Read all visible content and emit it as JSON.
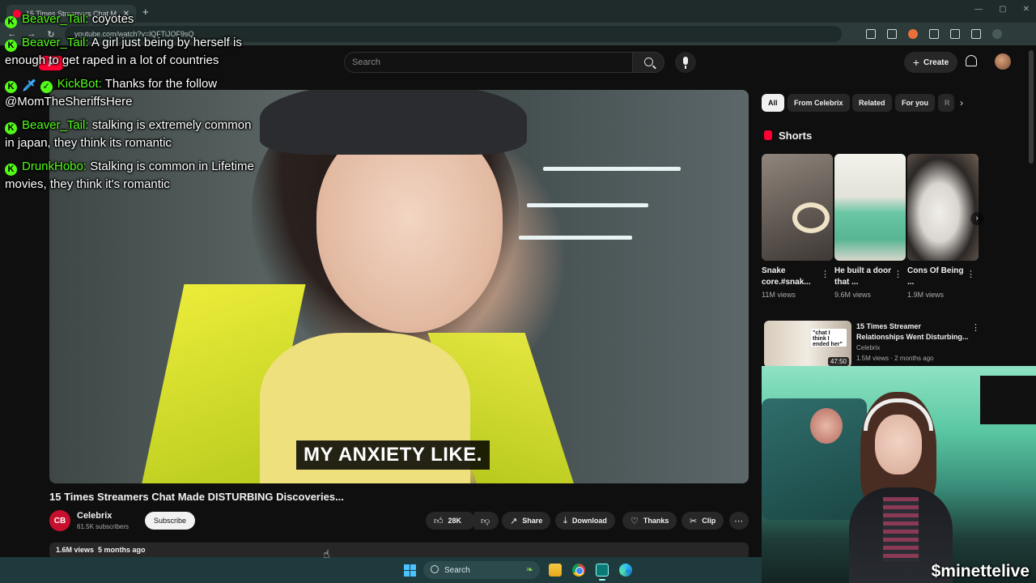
{
  "browser": {
    "tab_title": "15 Times Streamers Chat M",
    "url": "youtube.com/watch?v=lQFTiJOF9sQ"
  },
  "youtube": {
    "search_placeholder": "Search",
    "create_label": "Create"
  },
  "video": {
    "caption": "MY ANXIETY LIKE.",
    "title": "15 Times Streamers Chat Made DISTURBING Discoveries...",
    "channel": "Celebrix",
    "channel_initials": "CB",
    "subscribers": "61.5K subscribers",
    "subscribe_label": "Subscribe",
    "likes": "28K",
    "share_label": "Share",
    "download_label": "Download",
    "thanks_label": "Thanks",
    "clip_label": "Clip",
    "views": "1.6M views",
    "age": "5 months ago"
  },
  "sidebar": {
    "chips": [
      "All",
      "From Celebrix",
      "Related",
      "For you",
      "R"
    ],
    "shorts_label": "Shorts",
    "shorts": [
      {
        "title": "Snake core.#snak...",
        "views": "11M views"
      },
      {
        "title": "He built a door that ...",
        "views": "9.6M views"
      },
      {
        "title": "Cons Of Being ...",
        "views": "1.9M views"
      }
    ],
    "related": {
      "title": "15 Times Streamer Relationships Went Disturbing...",
      "channel": "Celebrix",
      "meta": "1.5M views · 2 months ago",
      "duration": "47:50",
      "thumb_text": "\"chat I think I ended her\""
    }
  },
  "chat": [
    {
      "user": "Beaver_Tail:",
      "text": "coyotes",
      "badges": [
        "k"
      ]
    },
    {
      "user": "Beaver_Tail:",
      "text": "A girl just being by herself is enough to get raped in a lot of countries",
      "badges": [
        "k"
      ]
    },
    {
      "user": "KickBot:",
      "text": "Thanks for the follow @MomTheSheriffsHere",
      "badges": [
        "k",
        "sword",
        "verified"
      ]
    },
    {
      "user": "Beaver_Tail:",
      "text": "stalking is extremely common in japan, they think its romantic",
      "badges": [
        "k"
      ]
    },
    {
      "user": "DrunkHobo:",
      "text": "Stalking is common in Lifetime movies, they think it's romantic",
      "badges": [
        "k"
      ]
    }
  ],
  "webcam": {
    "handle": "$minettelive"
  },
  "taskbar": {
    "search_label": "Search"
  }
}
